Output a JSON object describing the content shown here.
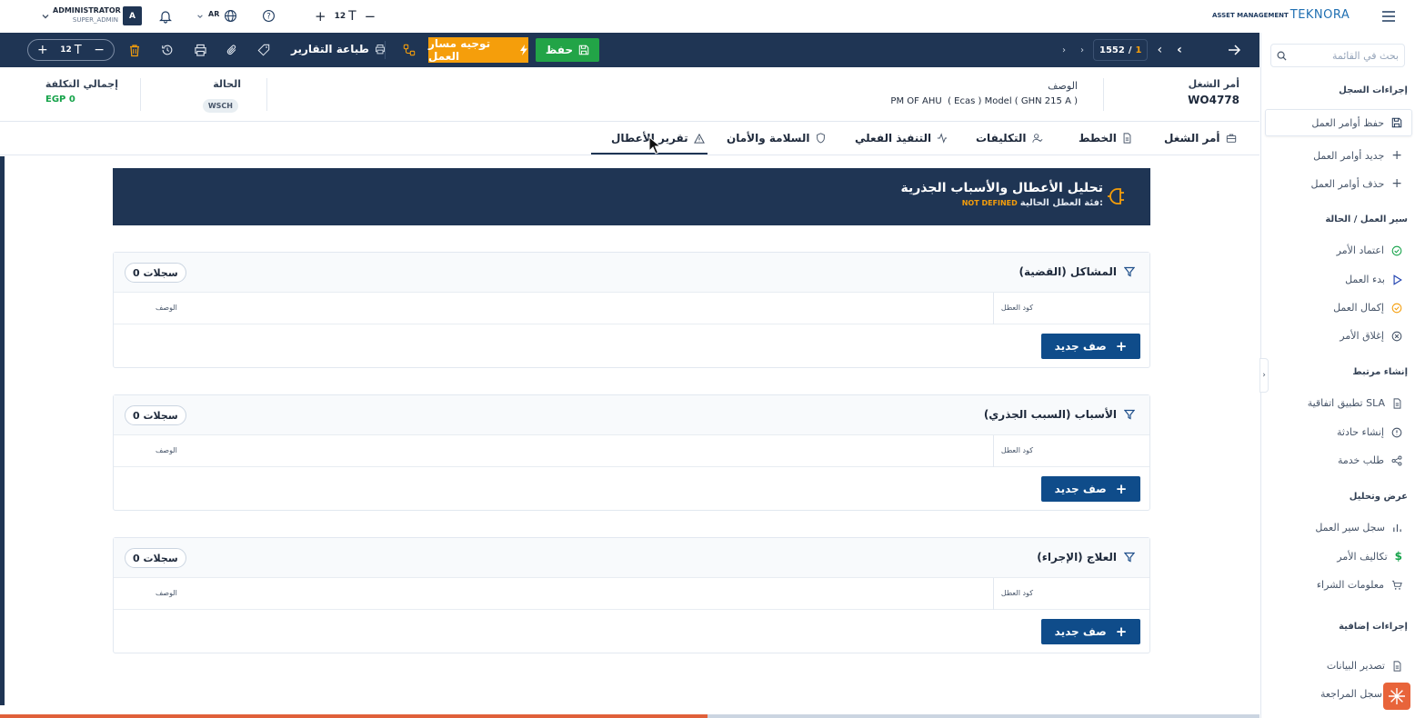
{
  "topbar": {
    "user_name": "ADMINISTRATOR",
    "user_role": "SUPER_ADMIN",
    "avatar_letter": "A",
    "lang": "AR",
    "font_size": "12",
    "brand_sub": "ASSET MANAGEMENT",
    "brand_name": "TEKNORA"
  },
  "toolbar": {
    "font_size": "12",
    "print_reports": "طباعة التقارير",
    "route_label": "توجيه مسار العمل",
    "save_label": "حفظ",
    "record_current": "1",
    "record_sep": "/",
    "record_total": "1552"
  },
  "header": {
    "wo_label": "أمر الشغل",
    "wo_value": "WO4778",
    "desc_label": "الوصف",
    "desc_value": "PM OF AHU  ( Ecas ) Model ( GHN 215 A )",
    "status_label": "الحالة",
    "status_value": "WSCH",
    "cost_label": "إجمالي التكلفة",
    "cost_value": "EGP 0"
  },
  "tabs": [
    {
      "label": "أمر الشغل"
    },
    {
      "label": "الخطط"
    },
    {
      "label": "التكليفات"
    },
    {
      "label": "التنفيذ الفعلي"
    },
    {
      "label": "السلامة والأمان"
    },
    {
      "label": "تقرير الأعطال"
    }
  ],
  "banner": {
    "title": "تحليل الأعطال والأسباب الجذرية",
    "subtitle_label": "فئة العطل الحالية:",
    "subtitle_value": "NOT DEFINED"
  },
  "panels": [
    {
      "title": "المشاكل (القضية)",
      "count": "0 سجلات",
      "col_code": "كود العطل",
      "col_desc": "الوصف",
      "add_label": "صف جديد"
    },
    {
      "title": "الأسباب (السبب الجذري)",
      "count": "0 سجلات",
      "col_code": "كود العطل",
      "col_desc": "الوصف",
      "add_label": "صف جديد"
    },
    {
      "title": "العلاج (الإجراء)",
      "count": "0 سجلات",
      "col_code": "كود العطل",
      "col_desc": "الوصف",
      "add_label": "صف جديد"
    }
  ],
  "sidebar": {
    "search_placeholder": "بحث في القائمة",
    "sections": [
      {
        "title": "إجراءات السجل",
        "items": [
          "حفظ أوامر العمل",
          "جديد أوامر العمل",
          "حذف أوامر العمل"
        ]
      },
      {
        "title": "سير العمل / الحالة",
        "items": [
          "اعتماد الأمر",
          "بدء العمل",
          "إكمال العمل",
          "إغلاق الأمر"
        ]
      },
      {
        "title": "إنشاء مرتبط",
        "items": [
          "تطبيق اتفاقية SLA",
          "إنشاء حادثة",
          "طلب خدمة"
        ]
      },
      {
        "title": "عرض وتحليل",
        "items": [
          "سجل سير العمل",
          "تكاليف الأمر",
          "معلومات الشراء"
        ]
      },
      {
        "title": "إجراءات إضافية",
        "items": [
          "تصدير البيانات",
          "سجل المراجعة"
        ]
      }
    ]
  },
  "colors": {
    "navy": "#1f3554",
    "green": "#22a447",
    "orange": "#f59e0b",
    "button_blue": "#0f4c8a"
  }
}
